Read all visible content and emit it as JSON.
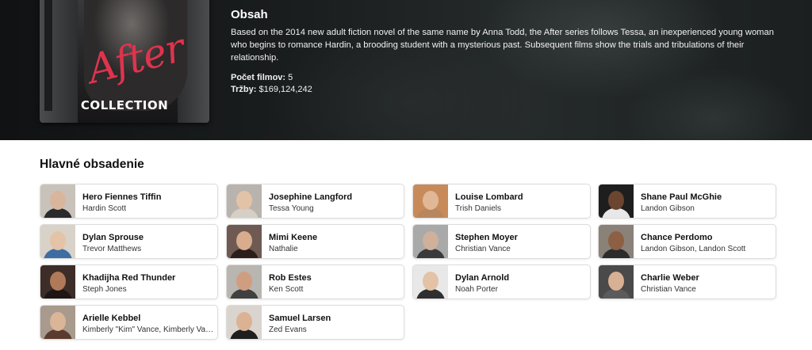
{
  "poster": {
    "title_script": "After",
    "subtitle": "COLLECTION"
  },
  "overview": {
    "heading": "Obsah",
    "text": "Based on the 2014 new adult fiction novel of the same name by Anna Todd, the After series follows Tessa, an inexperienced young woman who begins to romance Hardin, a brooding student with a mysterious past. Subsequent films show the trials and tribulations of their relationship.",
    "films_label": "Počet filmov:",
    "films_value": "5",
    "revenue_label": "Tržby:",
    "revenue_value": "$169,124,242"
  },
  "cast": {
    "heading": "Hlavné obsadenie",
    "members": [
      {
        "name": "Hero Fiennes Tiffin",
        "role": "Hardin Scott",
        "bg": "#c9c2bb",
        "skin": "#d9b59c",
        "cloth": "#2a2a2a"
      },
      {
        "name": "Josephine Langford",
        "role": "Tessa Young",
        "bg": "#b9b3ad",
        "skin": "#e2c3a8",
        "cloth": "#d6cfc6"
      },
      {
        "name": "Louise Lombard",
        "role": "Trish Daniels",
        "bg": "#c98a5a",
        "skin": "#e0b898",
        "cloth": "#b8865e"
      },
      {
        "name": "Shane Paul McGhie",
        "role": "Landon Gibson",
        "bg": "#1e1e1e",
        "skin": "#6b4530",
        "cloth": "#e8e8e8"
      },
      {
        "name": "Dylan Sprouse",
        "role": "Trevor Matthews",
        "bg": "#d8d2c8",
        "skin": "#e5c3a6",
        "cloth": "#3d6da3"
      },
      {
        "name": "Mimi Keene",
        "role": "Nathalie",
        "bg": "#6e5a52",
        "skin": "#d9ac8e",
        "cloth": "#2b1f1c"
      },
      {
        "name": "Stephen Moyer",
        "role": "Christian Vance",
        "bg": "#a9a9a9",
        "skin": "#cfb09a",
        "cloth": "#3a3a3a"
      },
      {
        "name": "Chance Perdomo",
        "role": "Landon Gibson, Landon Scott",
        "bg": "#8a8178",
        "skin": "#8d5f44",
        "cloth": "#2c2c2c"
      },
      {
        "name": "Khadijha Red Thunder",
        "role": "Steph Jones",
        "bg": "#3c2d28",
        "skin": "#b07a58",
        "cloth": "#1e1616"
      },
      {
        "name": "Rob Estes",
        "role": "Ken Scott",
        "bg": "#b9b5b0",
        "skin": "#cf9e80",
        "cloth": "#404040"
      },
      {
        "name": "Dylan Arnold",
        "role": "Noah Porter",
        "bg": "#e8e8e8",
        "skin": "#e3c2a6",
        "cloth": "#2f2f2f"
      },
      {
        "name": "Charlie Weber",
        "role": "Christian Vance",
        "bg": "#4a4a4a",
        "skin": "#d8b094",
        "cloth": "#5b5b5b"
      },
      {
        "name": "Arielle Kebbel",
        "role": "Kimberly \"Kim\" Vance, Kimberly Vance",
        "bg": "#a89a8c",
        "skin": "#dab598",
        "cloth": "#5a3b2e"
      },
      {
        "name": "Samuel Larsen",
        "role": "Zed Evans",
        "bg": "#d9d4cd",
        "skin": "#dcb294",
        "cloth": "#1f1f1f"
      }
    ]
  }
}
